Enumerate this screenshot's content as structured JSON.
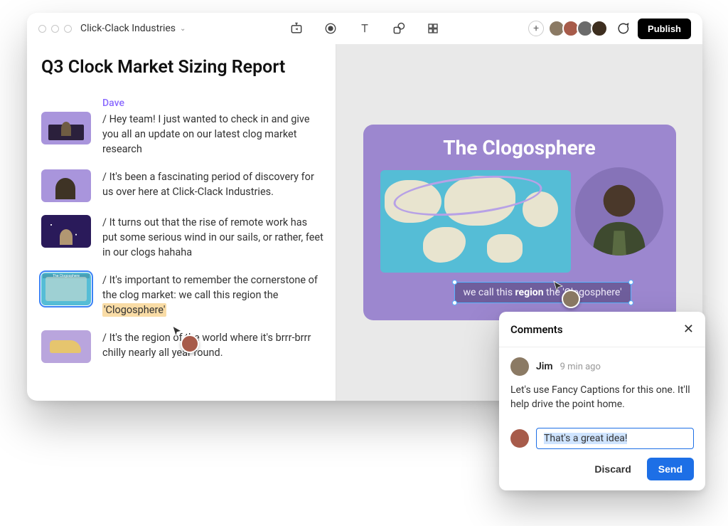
{
  "project_name": "Click-Clack Industries",
  "publish_label": "Publish",
  "doc_title": "Q3 Clock Market Sizing Report",
  "speaker": "Dave",
  "transcript": [
    "/ Hey team! I just wanted to check in and give you all an update on our latest clog market research",
    "/ It's been a fascinating period of discovery for us over here at Click-Clack Industries.",
    "/ It turns out that the rise of remote work has put some serious wind in our sails, or rather, feet in our clogs hahaha",
    "/ It's important to remember the cornerstone of the clog market: we call this region the ",
    "/ It's the region of the world where it's brrr-brrr chilly nearly all year round."
  ],
  "transcript_highlight": "'Clogosphere'",
  "avatar_colors": [
    "#8b7a64",
    "#a75b4a",
    "#6b6b6b",
    "#3d2e1f"
  ],
  "slide": {
    "title": "The Clogosphere",
    "caption_pre": "we call this ",
    "caption_bold": "region",
    "caption_post": " the 'Clogosphere'"
  },
  "comments": {
    "header": "Comments",
    "author": "Jim",
    "time": "9 min ago",
    "text": "Let's use Fancy Captions for this one. It'll help drive the point home.",
    "reply_value": "That's a great idea!",
    "discard": "Discard",
    "send": "Send"
  }
}
